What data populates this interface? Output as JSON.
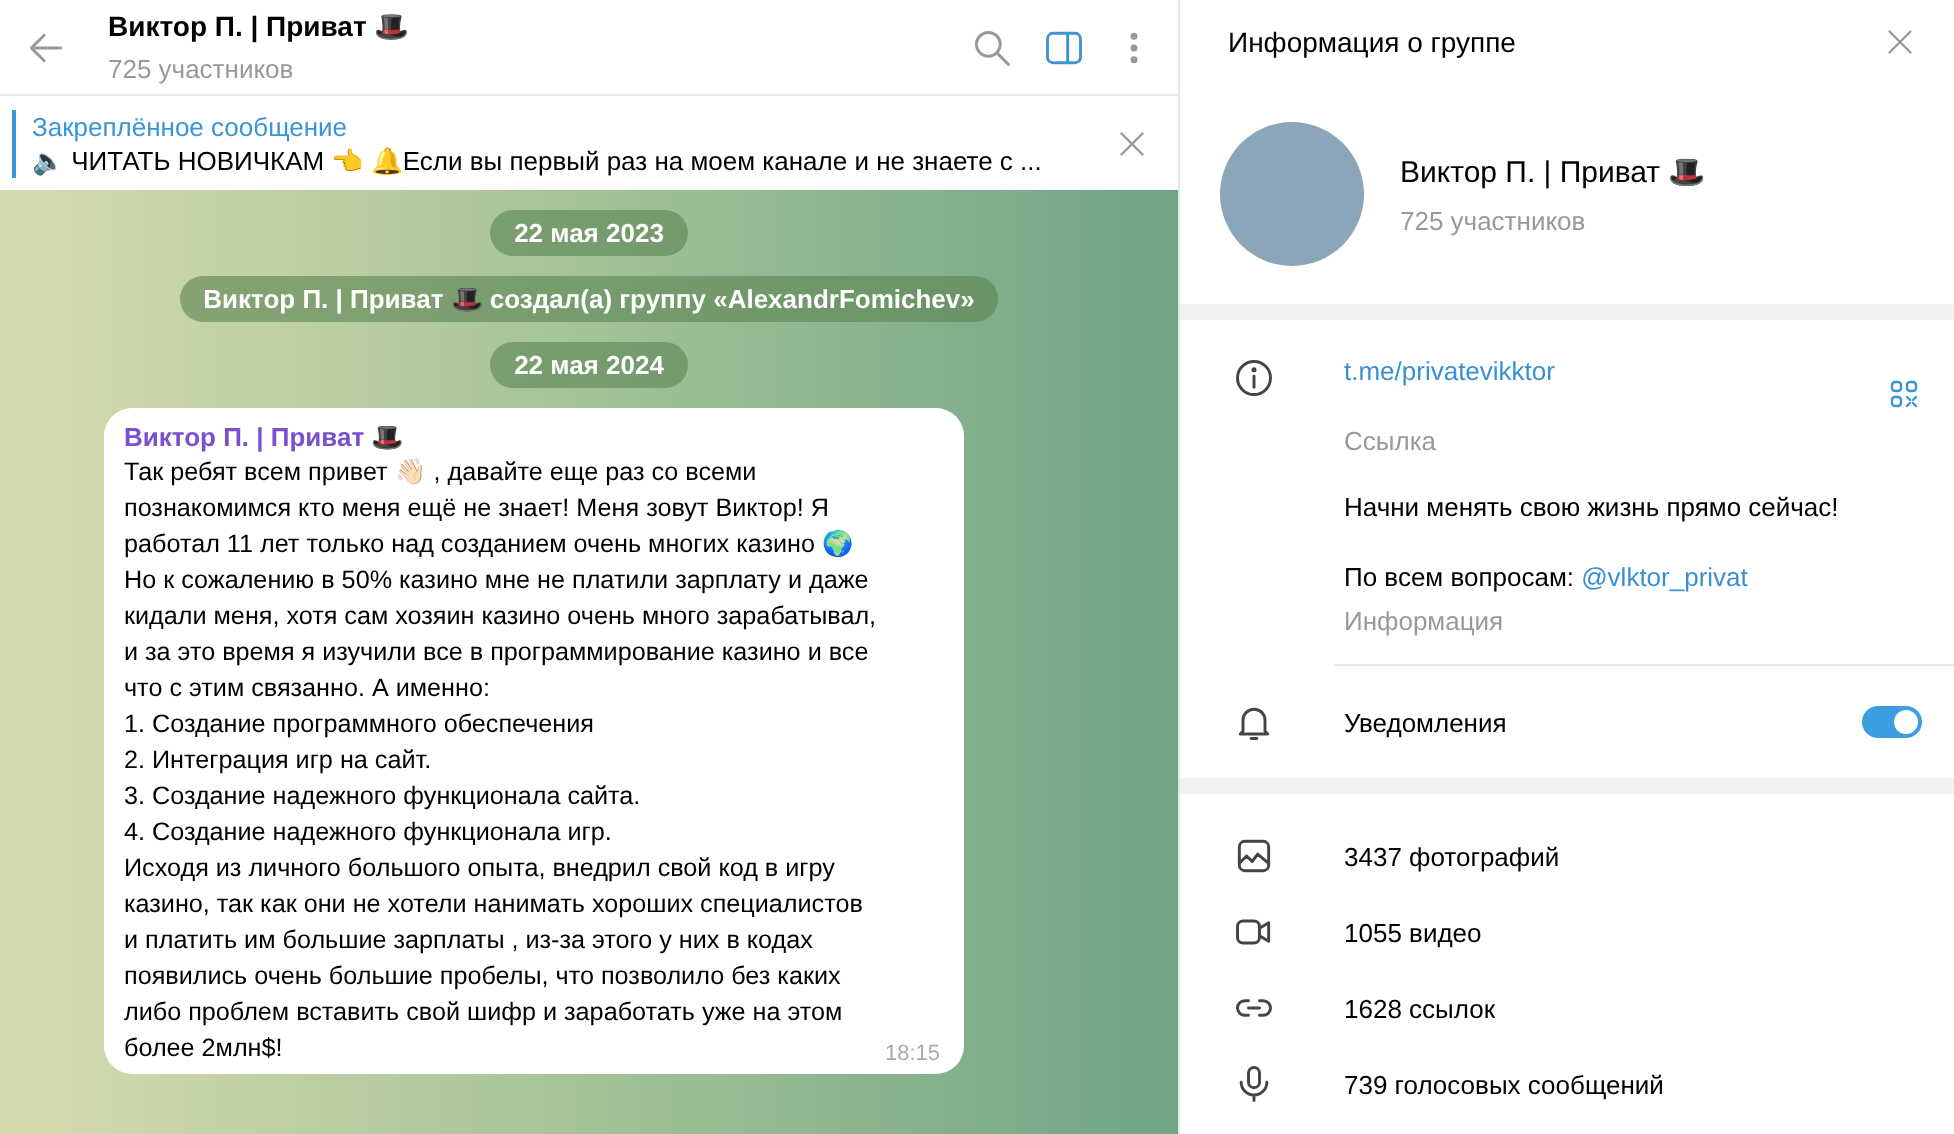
{
  "chat_header": {
    "title": "Виктор П. | Приват 🎩",
    "subtitle": "725 участников"
  },
  "pinned": {
    "label": "Закреплённое сообщение",
    "text": "🔈 ЧИТАТЬ НОВИЧКАМ 👈  🔔Если вы первый раз на моем канале и не знаете с ..."
  },
  "messages": [
    {
      "kind": "date",
      "text": "22 мая 2023"
    },
    {
      "kind": "service",
      "text": "Виктор П. | Приват 🎩 создал(а) группу «AlexandrFomichev»"
    },
    {
      "kind": "date",
      "text": "22 мая 2024"
    },
    {
      "kind": "post",
      "author": "Виктор П. | Приват 🎩",
      "paragraphs": [
        "Так ребят всем привет 👋🏻 , давайте еще раз со всеми\nпознакомимся кто меня ещё не знает! Меня зовут Виктор! Я\nработал 11 лет только над созданием очень многих казино 🌍\nНо к сожалению в 50% казино мне не платили зарплату и даже\nкидали меня, хотя сам хозяин казино очень много зарабатывал,\nи за это время я изучили все в программирование казино и все\nчто с этим связанно. А именно:\n1. Создание программного обеспечения\n2. Интеграция игр на сайт.\n3. Создание надежного функционала сайта.\n4. Создание надежного функционала игр.",
        "Исходя из личного большого опыта, внедрил свой код в игру\nказино, так как они не хотели нанимать хороших специалистов\nи платить им большие зарплаты , из-за этого у них в кодах\nпоявились очень большие пробелы, что позволило без каких\nлибо проблем вставить свой шифр и заработать уже на этом\nболее 2млн$!"
      ],
      "time": "18:15"
    }
  ],
  "info_panel": {
    "title": "Информация о группе",
    "name": "Виктор П. | Приват 🎩",
    "members": "725 участников",
    "link": "t.me/privatevikktor",
    "link_label": "Ссылка",
    "description": "Начни менять свою жизнь прямо сейчас!",
    "contact_prefix": "По всем вопросам: ",
    "contact": "@vlktor_privat",
    "description_label": "Информация",
    "notifications": {
      "label": "Уведомления",
      "on": true
    },
    "media": [
      {
        "kind": "photo",
        "text": "3437 фотографий"
      },
      {
        "kind": "video",
        "text": "1055 видео"
      },
      {
        "kind": "link",
        "text": "1628 ссылок"
      },
      {
        "kind": "voice",
        "text": "739 голосовых сообщений"
      }
    ]
  }
}
